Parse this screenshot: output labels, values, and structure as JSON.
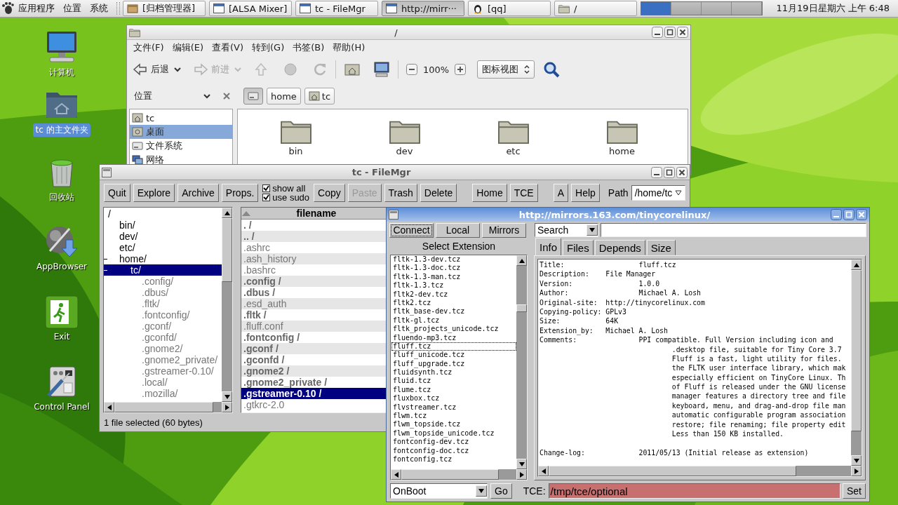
{
  "panel": {
    "menus": [
      "应用程序",
      "位置",
      "系统"
    ],
    "tasks": [
      {
        "label": "[归档管理器]",
        "selected": false
      },
      {
        "label": "[ALSA Mixer]",
        "selected": false
      },
      {
        "label": "tc - FileMgr",
        "selected": false
      },
      {
        "label": "http://mirr···",
        "selected": true
      },
      {
        "label": "[qq]",
        "selected": false
      },
      {
        "label": "/",
        "selected": false
      }
    ],
    "clock": "11月19日星期六 上午 6:48"
  },
  "desktop_icons": [
    {
      "label": "计算机",
      "selected": false
    },
    {
      "label": "tc 的主文件夹",
      "selected": true
    },
    {
      "label": "回收站",
      "selected": false
    },
    {
      "label": "AppBrowser",
      "selected": false
    },
    {
      "label": "Exit",
      "selected": false
    },
    {
      "label": "Control Panel",
      "selected": false
    }
  ],
  "file_browser": {
    "title": "/",
    "menu": [
      "文件(F)",
      "编辑(E)",
      "查看(V)",
      "转到(G)",
      "书签(B)",
      "帮助(H)"
    ],
    "toolbar": {
      "back": {
        "label": "后退",
        "disabled": false
      },
      "forward": {
        "label": "前进",
        "disabled": true
      },
      "zoom": "100%",
      "view": "图标视图"
    },
    "places_label": "位置",
    "breadcrumbs": [
      {
        "kind": "root",
        "selected": true
      },
      {
        "kind": "text",
        "label": "home",
        "selected": false
      },
      {
        "kind": "home",
        "label": "tc",
        "selected": false
      }
    ],
    "sidebar": [
      {
        "label": "tc",
        "selected": false
      },
      {
        "label": "桌面",
        "selected": true
      },
      {
        "label": "文件系统",
        "selected": false
      },
      {
        "label": "网络",
        "selected": false
      }
    ],
    "folders": [
      "bin",
      "dev",
      "etc",
      "home"
    ]
  },
  "fluff": {
    "title": "tc - FileMgr",
    "actions": [
      "Quit",
      "Explore",
      "Archive",
      "Props."
    ],
    "options": [
      {
        "label": "show all",
        "checked": true
      },
      {
        "label": "use sudo",
        "checked": true
      }
    ],
    "edit_buttons": [
      {
        "label": "Copy",
        "disabled": false
      },
      {
        "label": "Paste",
        "disabled": true
      },
      {
        "label": "Trash",
        "disabled": false
      },
      {
        "label": "Delete",
        "disabled": false
      }
    ],
    "nav_buttons": [
      "Home",
      "TCE"
    ],
    "help_buttons": [
      "A",
      "Help"
    ],
    "path": {
      "label": "Path",
      "value": "/home/tc"
    },
    "tree": [
      {
        "name": "/",
        "selected": false,
        "hidden": false,
        "children": [
          {
            "name": "bin/",
            "expanded": false,
            "selected": false,
            "hidden": false
          },
          {
            "name": "dev/",
            "expanded": false,
            "selected": false,
            "hidden": false
          },
          {
            "name": "etc/",
            "expanded": false,
            "selected": false,
            "hidden": false
          },
          {
            "name": "home/",
            "expanded": true,
            "selected": false,
            "hidden": false,
            "children": [
              {
                "name": "tc/",
                "expanded": true,
                "selected": true,
                "hidden": false,
                "children": [
                  {
                    "name": ".config/",
                    "expanded": false,
                    "selected": false,
                    "hidden": true
                  },
                  {
                    "name": ".dbus/",
                    "expanded": false,
                    "selected": false,
                    "hidden": true
                  },
                  {
                    "name": ".fltk/",
                    "expanded": false,
                    "selected": false,
                    "hidden": true
                  },
                  {
                    "name": ".fontconfig/",
                    "expanded": false,
                    "selected": false,
                    "hidden": true
                  },
                  {
                    "name": ".gconf/",
                    "expanded": false,
                    "selected": false,
                    "hidden": true
                  },
                  {
                    "name": ".gconfd/",
                    "expanded": false,
                    "selected": false,
                    "hidden": true
                  },
                  {
                    "name": ".gnome2/",
                    "expanded": false,
                    "selected": false,
                    "hidden": true
                  },
                  {
                    "name": ".gnome2_private/",
                    "expanded": false,
                    "selected": false,
                    "hidden": true
                  },
                  {
                    "name": ".gstreamer-0.10/",
                    "expanded": false,
                    "selected": false,
                    "hidden": true
                  },
                  {
                    "name": ".local/",
                    "expanded": false,
                    "selected": false,
                    "hidden": true
                  },
                  {
                    "name": ".mozilla/",
                    "expanded": false,
                    "selected": false,
                    "hidden": true
                  }
                ]
              }
            ]
          }
        ]
      }
    ],
    "file_column": "filename",
    "files": [
      {
        "name": ". /",
        "kind": "dir",
        "selected": false
      },
      {
        "name": ".. /",
        "kind": "dir",
        "selected": false
      },
      {
        "name": ".ashrc",
        "kind": "file",
        "selected": false
      },
      {
        "name": ".ash_history",
        "kind": "file",
        "selected": false
      },
      {
        "name": ".bashrc",
        "kind": "file",
        "selected": false
      },
      {
        "name": ".config /",
        "kind": "dir",
        "selected": false
      },
      {
        "name": ".dbus /",
        "kind": "dir",
        "selected": false
      },
      {
        "name": ".esd_auth",
        "kind": "file",
        "selected": false
      },
      {
        "name": ".fltk /",
        "kind": "dir",
        "selected": false
      },
      {
        "name": ".fluff.conf",
        "kind": "file",
        "selected": false
      },
      {
        "name": ".fontconfig /",
        "kind": "dir",
        "selected": false
      },
      {
        "name": ".gconf /",
        "kind": "dir",
        "selected": false
      },
      {
        "name": ".gconfd /",
        "kind": "dir",
        "selected": false
      },
      {
        "name": ".gnome2 /",
        "kind": "dir",
        "selected": false
      },
      {
        "name": ".gnome2_private /",
        "kind": "dir",
        "selected": false
      },
      {
        "name": ".gstreamer-0.10 /",
        "kind": "dir",
        "selected": true
      },
      {
        "name": ".gtkrc-2.0",
        "kind": "file",
        "selected": false
      }
    ],
    "status": "1 file selected (60 bytes)"
  },
  "app_browser": {
    "title": "http://mirrors.163.com/tinycorelinux/",
    "modes": [
      {
        "label": "Connect",
        "focused": true
      },
      {
        "label": "Local",
        "focused": false
      },
      {
        "label": "Mirrors",
        "focused": false
      }
    ],
    "search_mode": "Search",
    "list_label": "Select Extension",
    "extensions": [
      {
        "name": "fltk-1.3-dev.tcz",
        "selected": false
      },
      {
        "name": "fltk-1.3-doc.tcz",
        "selected": false
      },
      {
        "name": "fltk-1.3-man.tcz",
        "selected": false
      },
      {
        "name": "fltk-1.3.tcz",
        "selected": false
      },
      {
        "name": "fltk2-dev.tcz",
        "selected": false
      },
      {
        "name": "fltk2.tcz",
        "selected": false
      },
      {
        "name": "fltk_base-dev.tcz",
        "selected": false
      },
      {
        "name": "fltk-gl.tcz",
        "selected": false
      },
      {
        "name": "fltk_projects_unicode.tcz",
        "selected": false
      },
      {
        "name": "fluendo-mp3.tcz",
        "selected": false
      },
      {
        "name": "fluff.tcz",
        "selected": true
      },
      {
        "name": "fluff_unicode.tcz",
        "selected": false
      },
      {
        "name": "fluff_upgrade.tcz",
        "selected": false
      },
      {
        "name": "fluidsynth.tcz",
        "selected": false
      },
      {
        "name": "fluid.tcz",
        "selected": false
      },
      {
        "name": "flume.tcz",
        "selected": false
      },
      {
        "name": "fluxbox.tcz",
        "selected": false
      },
      {
        "name": "flvstreamer.tcz",
        "selected": false
      },
      {
        "name": "flwm.tcz",
        "selected": false
      },
      {
        "name": "flwm_topside.tcz",
        "selected": false
      },
      {
        "name": "flwm_topside_unicode.tcz",
        "selected": false
      },
      {
        "name": "fontconfig-dev.tcz",
        "selected": false
      },
      {
        "name": "fontconfig-doc.tcz",
        "selected": false
      },
      {
        "name": "fontconfig.tcz",
        "selected": false
      }
    ],
    "tabs": [
      {
        "label": "Info",
        "selected": true
      },
      {
        "label": "Files",
        "selected": false
      },
      {
        "label": "Depends",
        "selected": false
      },
      {
        "label": "Size",
        "selected": false
      }
    ],
    "info": [
      {
        "label": "Title:",
        "value": "fluff.tcz",
        "kind": "wide"
      },
      {
        "label": "Description:",
        "value": "File Manager",
        "kind": "narrow"
      },
      {
        "label": "Version:",
        "value": "1.0.0",
        "kind": "wide"
      },
      {
        "label": "Author:",
        "value": "Michael A. Losh",
        "kind": "wide"
      },
      {
        "label": "Original-site:",
        "value": "http://tinycorelinux.com",
        "kind": "narrow"
      },
      {
        "label": "Copying-policy:",
        "value": "GPLv3",
        "kind": "narrow"
      },
      {
        "label": "Size:",
        "value": "64K",
        "kind": "narrow"
      },
      {
        "label": "Extension_by:",
        "value": "Michael A. Losh",
        "kind": "narrow"
      }
    ],
    "comments": {
      "label": "Comments:",
      "lines": [
        "PPI compatible. Full Version including icon and",
        ".desktop file, suitable for Tiny Core 3.7",
        "Fluff is a fast, light utility for files.",
        "the FLTK user interface library, which mak",
        "especially efficient on TinyCore Linux. Th",
        "of Fluff is released under the GNU license",
        "manager features a directory tree and file",
        "keyboard, menu, and drag-and-drop file man",
        "automatic configurable program association",
        "restore; file renaming; file property edit",
        "Less than 150 KB installed."
      ]
    },
    "changelog": {
      "label": "Change-log:",
      "value": "2011/05/13 (Initial release as extension)"
    },
    "load_option": "OnBoot",
    "go": "Go",
    "tce": {
      "label": "TCE:",
      "value": "/tmp/tce/optional"
    },
    "set": "Set"
  }
}
